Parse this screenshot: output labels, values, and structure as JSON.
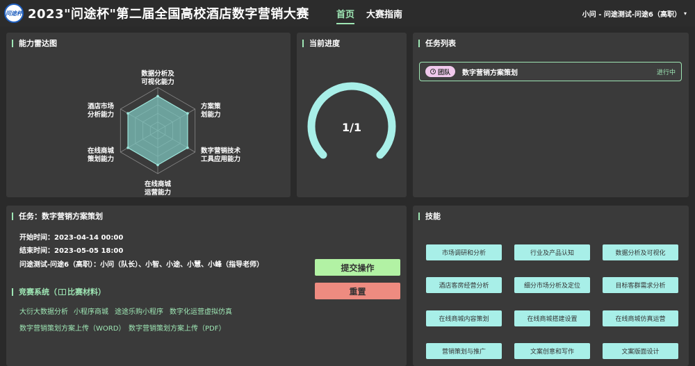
{
  "header": {
    "logo_text": "问途杯",
    "title": "2023\"问途杯\"第二届全国高校酒店数字营销大赛",
    "nav": {
      "home": "首页",
      "guide": "大赛指南"
    },
    "user": "小问 - 问途测试-问途6（高职）"
  },
  "radar": {
    "title": "能力雷达图",
    "labels": [
      [
        "数据分析及",
        "可视化能力"
      ],
      [
        "方案策",
        "划能力"
      ],
      [
        "数字营销技术",
        "工具应用能力"
      ],
      [
        "在线商城",
        "运营能力"
      ],
      [
        "在线商城",
        "策划能力"
      ],
      [
        "酒店市场",
        "分析能力"
      ]
    ],
    "values": [
      0.8,
      0.8,
      0.8,
      0.8,
      0.8,
      0.8
    ],
    "levels": 5,
    "max": 1,
    "colors": {
      "fill": "#7ec4bd",
      "stroke": "#9ee6dc",
      "grid": "#888888"
    }
  },
  "progress": {
    "title": "当前进度",
    "text": "1/1",
    "completed": 1,
    "total": 1,
    "color": "#a8efe8"
  },
  "tasks": {
    "title": "任务列表",
    "items": [
      {
        "badge": "团队",
        "name": "数字营销方案策划",
        "status": "进行中"
      }
    ]
  },
  "task": {
    "title": "任务：数字营销方案策划",
    "start": "开始时间：2023-04-14 00:00",
    "end": "结束时间：2023-05-05 18:00",
    "team": "问途测试-问途6（高职）：小问（队长）、小智、小途、小慧、小峰（指导老师）",
    "system_title_prefix": "竞赛系统（",
    "system_title_link": "比赛材料",
    "system_title_suffix": "）",
    "systems": [
      "大衍大数据分析",
      "小程序商城",
      "途途乐购小程序",
      "数字化运营虚拟仿真"
    ],
    "uploads": [
      "数字营销策划方案上传（WORD）",
      "数字营销策划方案上传（PDF）"
    ],
    "submit": "提交操作",
    "reset": "重置"
  },
  "skills": {
    "title": "技能",
    "items": [
      "市场调研和分析",
      "行业及产品认知",
      "数据分析及可视化",
      "酒店客房经营分析",
      "细分市场分析及定位",
      "目标客群需求分析",
      "在线商城内容策划",
      "在线商城搭建设置",
      "在线商城仿真运营",
      "营销策划与推广",
      "文案创意和写作",
      "文案版面设计"
    ]
  }
}
